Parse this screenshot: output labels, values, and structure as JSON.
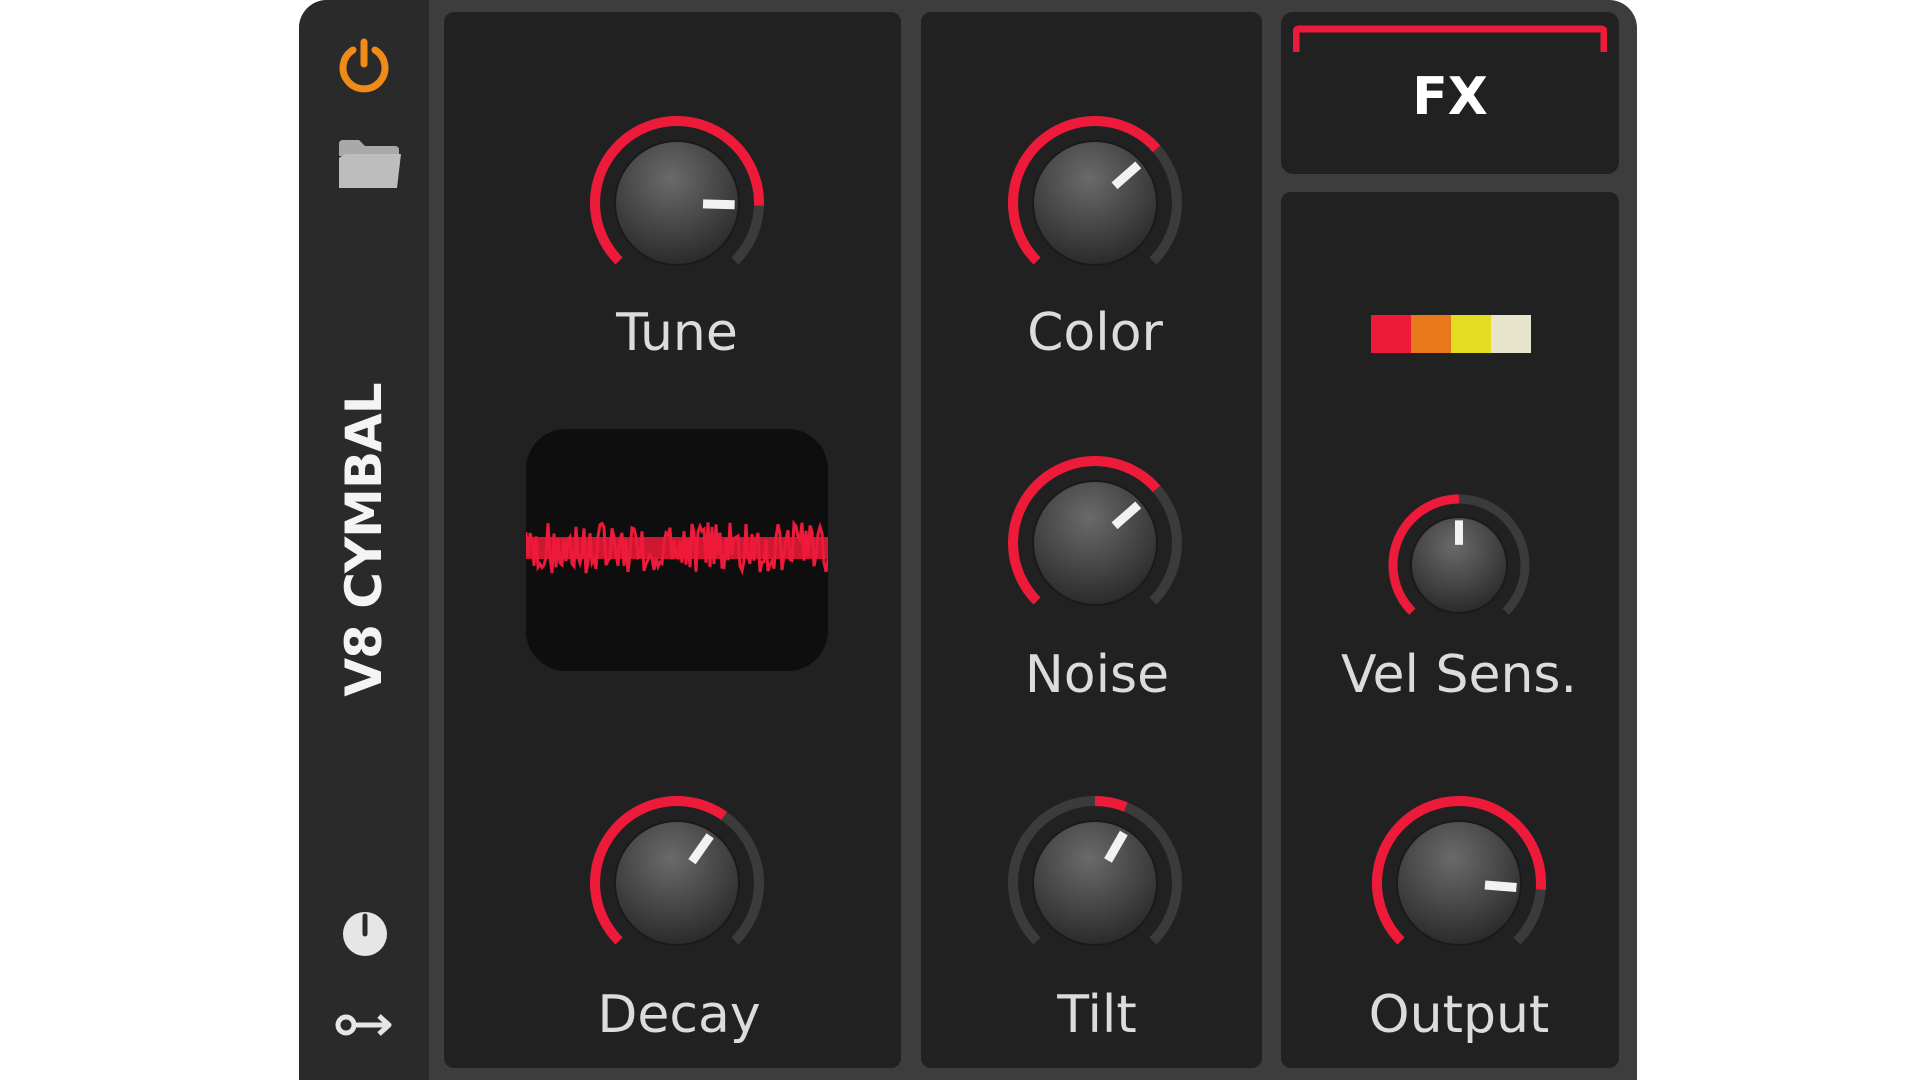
{
  "device": {
    "title": "V8 CYMBAL"
  },
  "sidebar": {
    "icons": [
      "power-icon",
      "folder-icon",
      "modulation-knob-icon",
      "key-icon"
    ],
    "power_color": "#f08a18",
    "icon_color": "#d6d6d6"
  },
  "knobs": [
    {
      "id": "tune",
      "label": "Tune",
      "value": 0.84
    },
    {
      "id": "color",
      "label": "Color",
      "value": 0.68
    },
    {
      "id": "noise",
      "label": "Noise",
      "value": 0.68
    },
    {
      "id": "decay",
      "label": "Decay",
      "value": 0.63
    },
    {
      "id": "tilt",
      "label": "Tilt",
      "value": 0.5,
      "bipolar": true
    },
    {
      "id": "vel-sens",
      "label": "Vel Sens.",
      "value": 0.5
    },
    {
      "id": "output",
      "label": "Output",
      "value": 0.85
    }
  ],
  "fx": {
    "label": "FX",
    "accent": "#ee1a3a"
  },
  "color_swatches": [
    "#ee1a3a",
    "#e8781c",
    "#e2dc22",
    "#e7e4cc"
  ],
  "theme": {
    "accent": "#ee1a3a",
    "track": "#3b3b3b",
    "panel": "#212121",
    "frame": "#3d3d3d"
  }
}
